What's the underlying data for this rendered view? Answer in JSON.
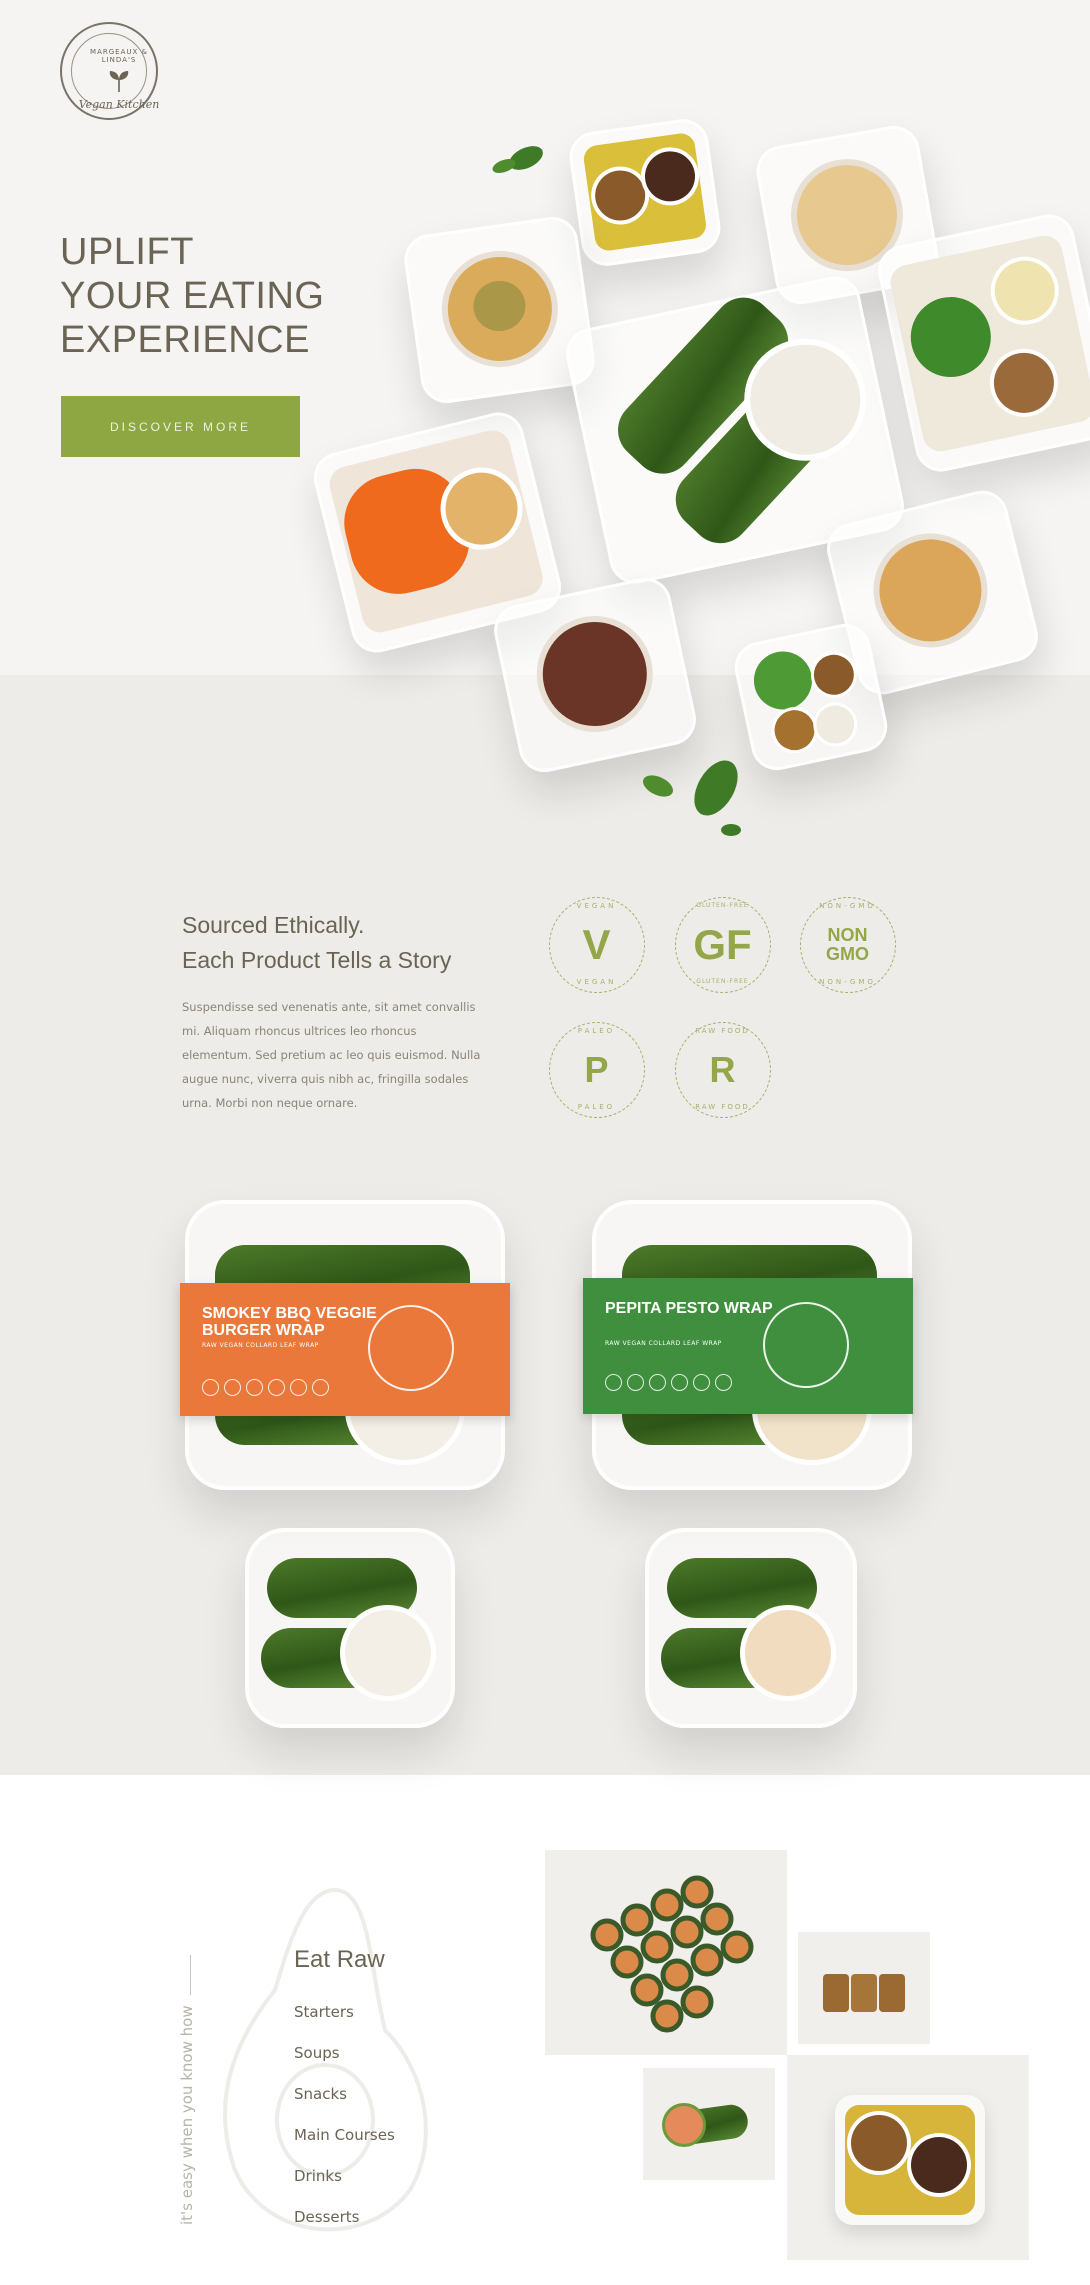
{
  "brand": {
    "top_text": "MARGEAUX & LINDA'S",
    "bottom_text": "Vegan Kitchen",
    "logo_icon": "leaf-sprout-icon"
  },
  "hero": {
    "headline_line1": "UPLIFT",
    "headline_line2": "YOUR EATING",
    "headline_line3": "EXPERIENCE",
    "cta_label": "DISCOVER MORE"
  },
  "ethics": {
    "title_line1": "Sourced Ethically.",
    "title_line2": "Each Product Tells a Story",
    "body": "Suspendisse sed venenatis ante, sit amet convallis mi. Aliquam rhoncus ultrices leo rhoncus elementum. Sed pretium ac leo quis euismod. Nulla augue nunc, viverra quis nibh ac, fringilla sodales urna. Morbi non neque ornare.",
    "badges": [
      {
        "mark": "V",
        "ring_top": "VEGAN",
        "ring_bottom": "VEGAN"
      },
      {
        "mark": "GF",
        "ring_top": "GLUTEN-FREE",
        "ring_bottom": "GLUTEN-FREE"
      },
      {
        "mark_line1": "NON",
        "mark_line2": "GMO",
        "ring_top": "NON-GMO",
        "ring_bottom": "NON-GMO"
      },
      {
        "mark": "P",
        "ring_top": "PALEO",
        "ring_bottom": "PALEO"
      },
      {
        "mark": "R",
        "ring_top": "RAW FOOD",
        "ring_bottom": "RAW FOOD"
      }
    ],
    "accent_color": "#93a74a"
  },
  "products": [
    {
      "name": "SMOKEY BBQ VEGGIE BURGER WRAP",
      "subtitle": "RAW VEGAN COLLARD LEAF WRAP",
      "color": "#e9783a"
    },
    {
      "name": "PEPITA PESTO WRAP",
      "subtitle": "RAW VEGAN COLLARD LEAF WRAP",
      "color": "#3f8f3f"
    }
  ],
  "menu": {
    "tagline": "it's easy when you know how",
    "title": "Eat Raw",
    "items": [
      "Starters",
      "Soups",
      "Snacks",
      "Main Courses",
      "Drinks",
      "Desserts"
    ]
  }
}
